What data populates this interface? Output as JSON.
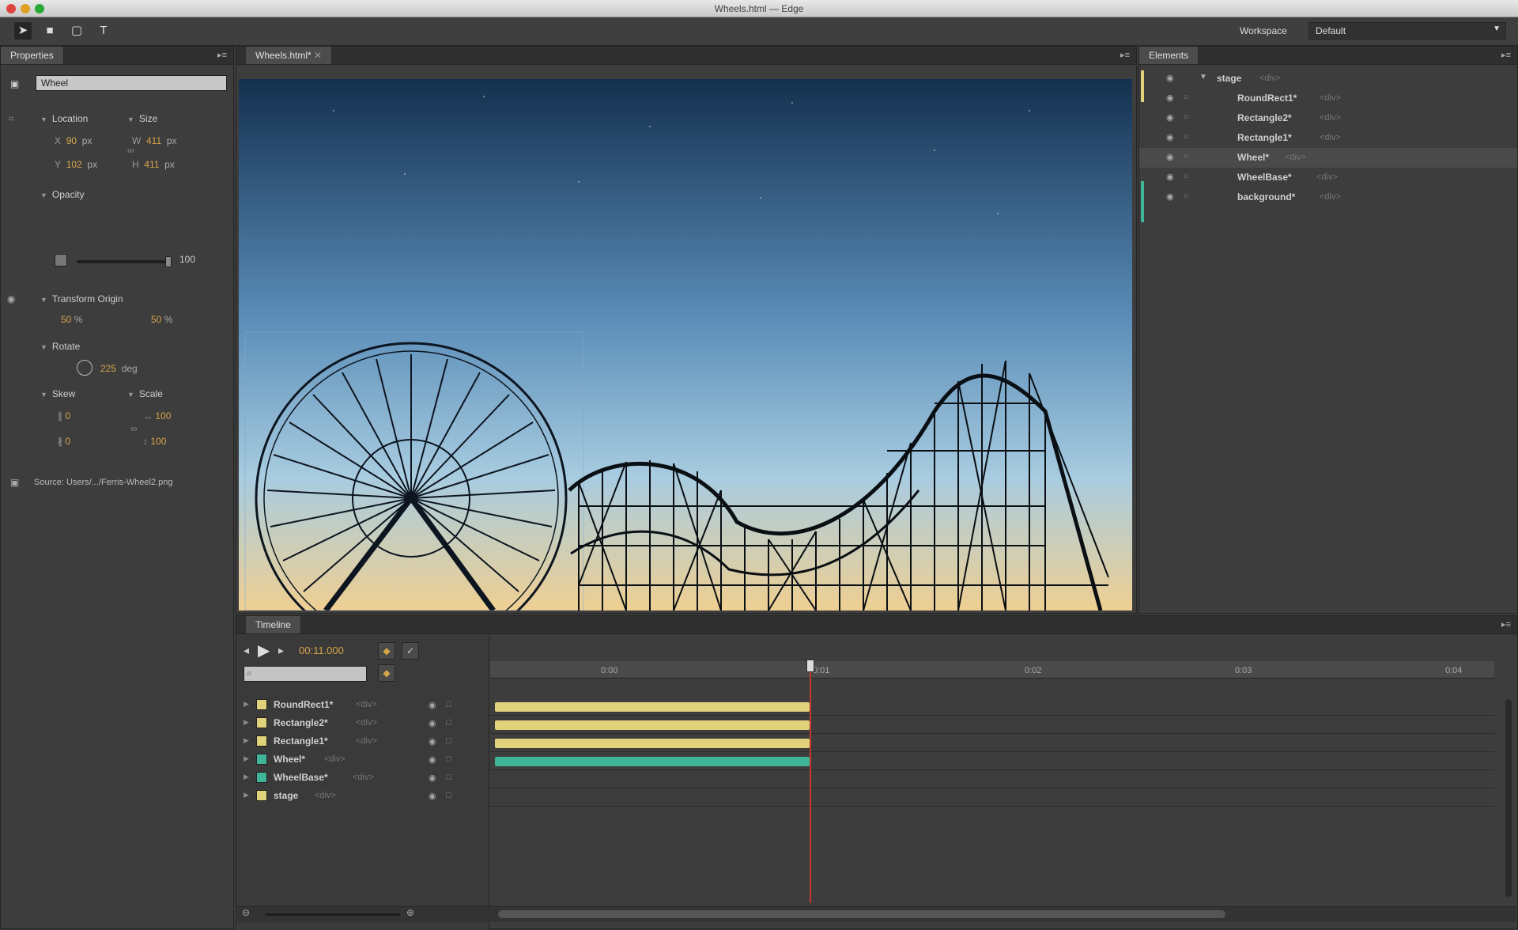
{
  "window": {
    "title": "Wheels.html — Edge"
  },
  "toolbar": {
    "workspace_label": "Workspace",
    "workspace_value": "Default"
  },
  "properties": {
    "tab": "Properties",
    "element_name": "Wheel",
    "location_label": "Location",
    "size_label": "Size",
    "x_value": "90",
    "y_value": "102",
    "w_value": "411",
    "h_value": "411",
    "unit_px": "px",
    "opacity_label": "Opacity",
    "opacity_value": "100",
    "transform_origin_label": "Transform Origin",
    "origin_x": "50",
    "origin_y": "50",
    "rotate_label": "Rotate",
    "rotate_value": "225",
    "rotate_unit": "deg",
    "skew_label": "Skew",
    "scale_label": "Scale",
    "skew_x": "0",
    "skew_y": "0",
    "scale_x": "100",
    "scale_y": "100",
    "source_text": "Source: Users/.../Ferris-Wheel2.png"
  },
  "stage": {
    "tab": "Wheels.html*"
  },
  "elements": {
    "tab": "Elements",
    "items": [
      {
        "name": "stage",
        "tag": "<div>"
      },
      {
        "name": "RoundRect1*",
        "tag": "<div>"
      },
      {
        "name": "Rectangle2*",
        "tag": "<div>"
      },
      {
        "name": "Rectangle1*",
        "tag": "<div>"
      },
      {
        "name": "Wheel*",
        "tag": "<div>"
      },
      {
        "name": "WheelBase*",
        "tag": "<div>"
      },
      {
        "name": "background*",
        "tag": "<div>"
      }
    ]
  },
  "timeline": {
    "tab": "Timeline",
    "time": "00:11.000",
    "ruler": [
      "0:00",
      "0:01",
      "0:02",
      "0:03",
      "0:04"
    ],
    "layers": [
      {
        "name": "RoundRect1*",
        "tag": "<div>",
        "color": "#e0d27a"
      },
      {
        "name": "Rectangle2*",
        "tag": "<div>",
        "color": "#e0d27a"
      },
      {
        "name": "Rectangle1*",
        "tag": "<div>",
        "color": "#e0d27a"
      },
      {
        "name": "Wheel*",
        "tag": "<div>",
        "color": "#3fb59a"
      },
      {
        "name": "WheelBase*",
        "tag": "<div>",
        "color": "#3fb59a"
      },
      {
        "name": "stage",
        "tag": "<div>",
        "color": "#e0d27a"
      }
    ]
  },
  "colors": {
    "accent_yellow": "#e0d27a",
    "accent_teal": "#3fb59a",
    "playhead": "#c0392b",
    "value_orange": "#d6a54a"
  }
}
